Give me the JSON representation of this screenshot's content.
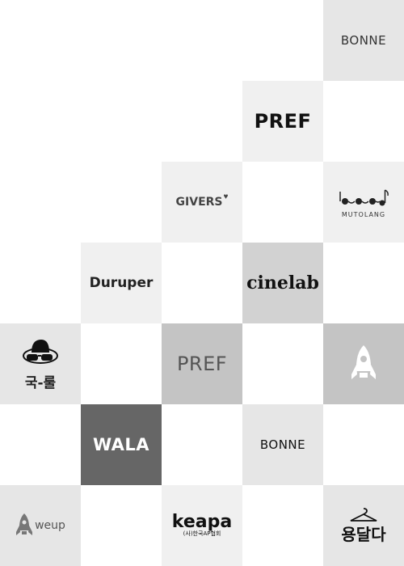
{
  "colors": {
    "background": "#ffffff",
    "tile_light": "#f0f0f0",
    "tile_medium": "#e6e6e6",
    "tile_mid": "#d2d2d2",
    "tile_dark": "#c4c4c4",
    "tile_darker": "#b9b9b9",
    "tile_darkest": "#666666"
  },
  "tiles": {
    "bonne_top": {
      "icon": "bonne-logo",
      "text_pre": "BO",
      "text_ww": "NN",
      "text_post": "E"
    },
    "pref_top": {
      "icon": "pref-logo",
      "text": "PREF"
    },
    "givers": {
      "icon": "givers-logo",
      "text": "GIVERS",
      "mark": "heart-icon"
    },
    "mutolang": {
      "icon": "mutolang-logo",
      "text": "MUTOLANG"
    },
    "duruper": {
      "icon": "duruper-logo",
      "text": "Duruper"
    },
    "cinelab": {
      "icon": "cinelab-logo",
      "text": "cinelab"
    },
    "gukrul": {
      "icon": "sunglasses-mascot-icon",
      "text": "국-룰"
    },
    "pref_gray": {
      "icon": "pref-logo",
      "text": "PREF"
    },
    "rocket": {
      "icon": "rocket-icon"
    },
    "wala": {
      "icon": "wala-logo",
      "text": "WALA"
    },
    "bonne_mid": {
      "icon": "bonne-logo",
      "text_pre": "BO",
      "text_ww": "NN",
      "text_post": "E"
    },
    "weup": {
      "icon": "rocket-icon",
      "text": "weup"
    },
    "keapa": {
      "icon": "keapa-logo",
      "text": "keapa",
      "subtitle": "(사)한국AP협회"
    },
    "yong": {
      "icon": "hanger-icon",
      "text": "용달다"
    }
  }
}
